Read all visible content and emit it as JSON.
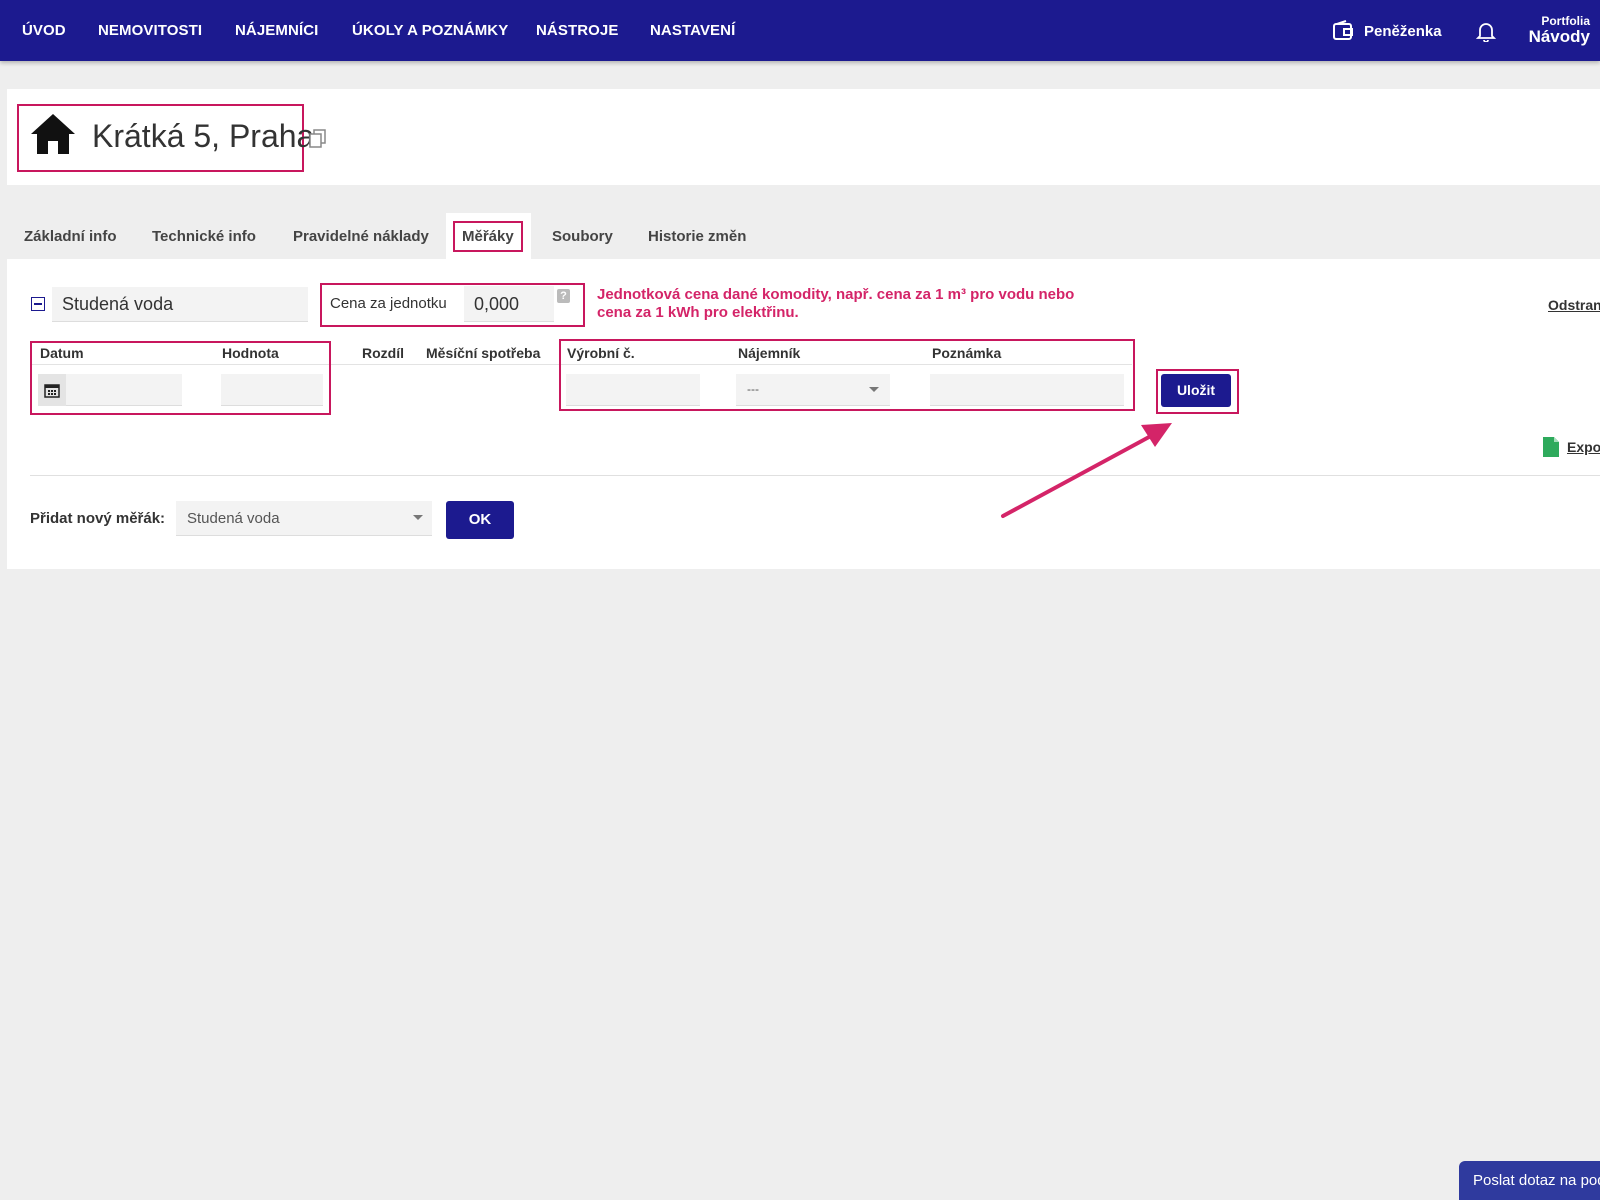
{
  "nav": {
    "items": [
      "ÚVOD",
      "NEMOVITOSTI",
      "NÁJEMNÍCI",
      "ÚKOLY A POZNÁMKY",
      "NÁSTROJE",
      "NASTAVENÍ"
    ],
    "wallet_label": "Peněženka",
    "portfolio_small": "Portfolia",
    "portfolio_big": "Návody"
  },
  "property": {
    "title": "Krátká 5, Praha"
  },
  "tabs": [
    "Základní info",
    "Technické info",
    "Pravidelné náklady",
    "Měřáky",
    "Soubory",
    "Historie změn"
  ],
  "meter": {
    "name": "Studená voda",
    "price_label": "Cena za jednotku",
    "price_value": "0,000",
    "help": "?",
    "note": "Jednotková cena dané komodity, např. cena za 1 m³ pro vodu nebo cena za 1 kWh pro elektřinu.",
    "remove_link": "Odstranit",
    "columns": [
      "Datum",
      "Hodnota",
      "Rozdíl",
      "Měsíční spotřeba",
      "Výrobní č.",
      "Nájemník",
      "Poznámka"
    ],
    "tenant_default": "---",
    "save_button": "Uložit",
    "export_link": "Export"
  },
  "add_meter": {
    "label": "Přidat nový měřák:",
    "selected": "Studená voda",
    "ok_button": "OK"
  },
  "chat": {
    "label": "Poslat dotaz na podporu"
  },
  "colors": {
    "nav_bg": "#1c1a8f",
    "highlight": "#c8175d",
    "note_text": "#d42468",
    "button": "#1c1a8f"
  }
}
